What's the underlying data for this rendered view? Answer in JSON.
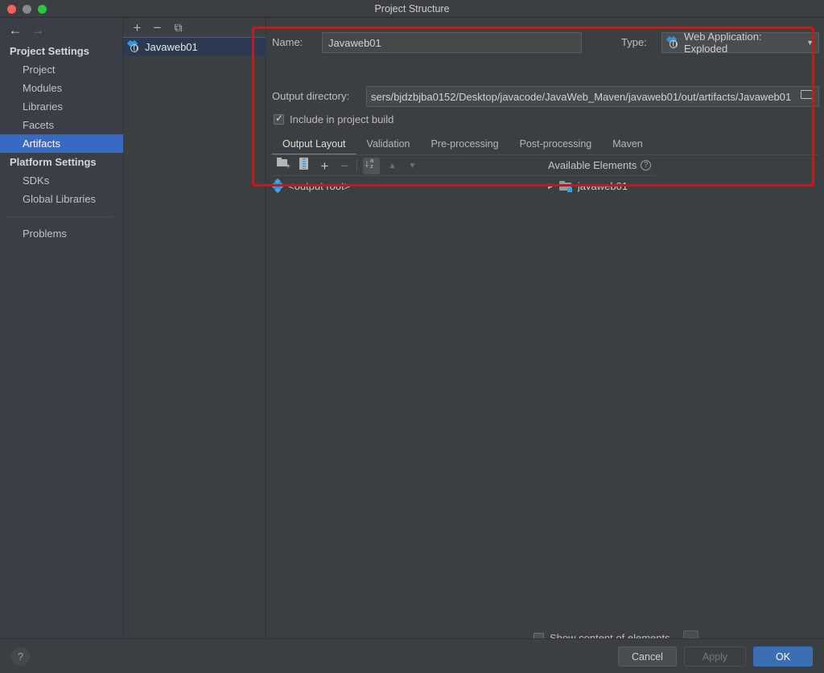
{
  "window": {
    "title": "Project Structure",
    "traffic_lights": [
      "close-dot",
      "minimize-dot",
      "maximize-dot"
    ]
  },
  "sidebar": {
    "nav": {
      "back_icon": "arrow-left-icon",
      "forward_icon": "arrow-right-icon"
    },
    "groups": [
      {
        "label": "Project Settings",
        "items": [
          {
            "label": "Project",
            "selected": false
          },
          {
            "label": "Modules",
            "selected": false
          },
          {
            "label": "Libraries",
            "selected": false
          },
          {
            "label": "Facets",
            "selected": false
          },
          {
            "label": "Artifacts",
            "selected": true
          }
        ]
      },
      {
        "label": "Platform Settings",
        "items": [
          {
            "label": "SDKs",
            "selected": false
          },
          {
            "label": "Global Libraries",
            "selected": false
          }
        ]
      }
    ],
    "extra_items": [
      {
        "label": "Problems",
        "selected": false
      }
    ],
    "selected_color": "#3869c5"
  },
  "artifacts_panel": {
    "toolbar": [
      {
        "name": "add-artifact-button",
        "glyph": "+"
      },
      {
        "name": "remove-artifact-button",
        "glyph": "−"
      },
      {
        "name": "copy-artifact-button",
        "glyph": "⧉"
      }
    ],
    "items": [
      {
        "label": "Javaweb01",
        "icon": "web-application-artifact-icon",
        "selected": true
      }
    ]
  },
  "detail": {
    "name_label": "Name:",
    "name_value": "Javaweb01",
    "type_label": "Type:",
    "type_value": "Web Application: Exploded",
    "type_icon": "web-application-artifact-icon",
    "output_dir_label": "Output directory:",
    "output_dir_value": "sers/bjdzbjba0152/Desktop/javacode/JavaWeb_Maven/javaweb01/out/artifacts/Javaweb01",
    "output_dir_browse_icon": "folder-browse-icon",
    "include_in_build_label": "Include in project build",
    "include_in_build_checked": true,
    "tabs": [
      {
        "label": "Output Layout",
        "active": true
      },
      {
        "label": "Validation",
        "active": false
      },
      {
        "label": "Pre-processing",
        "active": false
      },
      {
        "label": "Post-processing",
        "active": false
      },
      {
        "label": "Maven",
        "active": false
      }
    ],
    "layout_toolbar": [
      {
        "name": "add-directory-button",
        "icon": "add-folder-icon",
        "state": "enabled"
      },
      {
        "name": "add-archive-button",
        "icon": "archive-icon",
        "state": "enabled"
      },
      {
        "name": "add-element-button",
        "icon": "plus-dropdown-icon",
        "state": "enabled"
      },
      {
        "name": "remove-element-button",
        "icon": "minus-icon",
        "state": "disabled"
      },
      {
        "name": "sort-elements-button",
        "icon": "sort-az-icon",
        "state": "selected"
      },
      {
        "name": "move-up-button",
        "icon": "chevron-up-icon",
        "state": "disabled"
      },
      {
        "name": "move-down-button",
        "icon": "chevron-down-icon",
        "state": "disabled"
      }
    ],
    "output_tree": [
      {
        "label": "<output root>",
        "icon": "output-root-icon"
      }
    ],
    "available_elements_label": "Available Elements",
    "available_elements_help_icon": "help-circle-icon",
    "available_tree": [
      {
        "label": "javaweb01",
        "icon": "module-folder-icon",
        "expander": "triangle-right-icon"
      }
    ],
    "show_content_label": "Show content of elements",
    "show_content_checked": false,
    "show_content_more_label": "...",
    "tab_accent_color": "#4a88d6"
  },
  "footer": {
    "help_label": "?",
    "cancel_label": "Cancel",
    "apply_label": "Apply",
    "apply_enabled": false,
    "ok_label": "OK",
    "ok_color": "#3c6eb4"
  },
  "annotation": {
    "type": "red-rectangle-highlight",
    "color": "#fe0000"
  }
}
